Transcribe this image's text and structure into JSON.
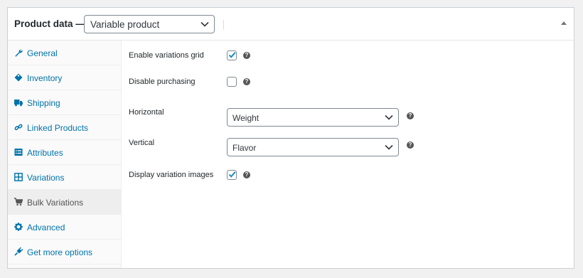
{
  "header": {
    "title": "Product data —",
    "product_type": "Variable product"
  },
  "tabs": [
    {
      "label": "General",
      "icon": "wrench-icon",
      "active": false
    },
    {
      "label": "Inventory",
      "icon": "tag-icon",
      "active": false
    },
    {
      "label": "Shipping",
      "icon": "truck-icon",
      "active": false
    },
    {
      "label": "Linked Products",
      "icon": "link-icon",
      "active": false
    },
    {
      "label": "Attributes",
      "icon": "list-icon",
      "active": false
    },
    {
      "label": "Variations",
      "icon": "grid-icon",
      "active": false
    },
    {
      "label": "Bulk Variations",
      "icon": "cart-icon",
      "active": true
    },
    {
      "label": "Advanced",
      "icon": "gear-icon",
      "active": false
    },
    {
      "label": "Get more options",
      "icon": "plugin-icon",
      "active": false
    }
  ],
  "fields": {
    "enable_grid": {
      "label": "Enable variations grid",
      "checked": true
    },
    "disable_purchasing": {
      "label": "Disable purchasing",
      "checked": false
    },
    "horizontal": {
      "label": "Horizontal",
      "value": "Weight"
    },
    "vertical": {
      "label": "Vertical",
      "value": "Flavor"
    },
    "display_images": {
      "label": "Display variation images",
      "checked": true
    }
  },
  "help_glyph": "?",
  "colors": {
    "link": "#0073aa",
    "checkbox": "#1e8cbe",
    "active_tab_bg": "#eeeeee"
  }
}
